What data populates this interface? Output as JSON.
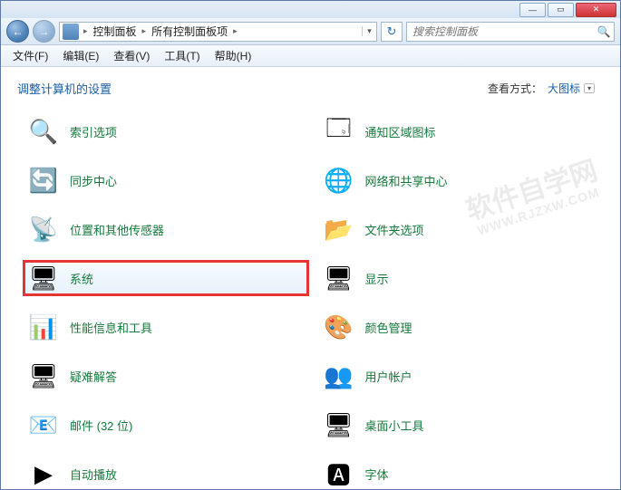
{
  "titlebar": {
    "min": "—",
    "max": "▭",
    "close": "✕"
  },
  "nav": {
    "back": "←",
    "fwd": "→",
    "crumbs": [
      "控制面板",
      "所有控制面板项"
    ],
    "sep": "▸",
    "dropdown": "▾",
    "refresh": "↻"
  },
  "search": {
    "placeholder": "搜索控制面板",
    "icon": "🔍"
  },
  "menus": [
    {
      "k": "file",
      "t": "文件(F)"
    },
    {
      "k": "edit",
      "t": "编辑(E)"
    },
    {
      "k": "view",
      "t": "查看(V)"
    },
    {
      "k": "tools",
      "t": "工具(T)"
    },
    {
      "k": "help",
      "t": "帮助(H)"
    }
  ],
  "page": {
    "title": "调整计算机的设置",
    "view_label": "查看方式：",
    "view_value": "大图标",
    "view_dd": "▾"
  },
  "items_left": [
    {
      "k": "indexing",
      "t": "索引选项",
      "ico": "🔍"
    },
    {
      "k": "sync",
      "t": "同步中心",
      "ico": "🔄"
    },
    {
      "k": "sensors",
      "t": "位置和其他传感器",
      "ico": "📡"
    },
    {
      "k": "system",
      "t": "系统",
      "ico": "🖥",
      "hl": true
    },
    {
      "k": "perf",
      "t": "性能信息和工具",
      "ico": "📊"
    },
    {
      "k": "trouble",
      "t": "疑难解答",
      "ico": "🖥"
    },
    {
      "k": "mail",
      "t": "邮件 (32 位)",
      "ico": "📧"
    },
    {
      "k": "autoplay",
      "t": "自动播放",
      "ico": "▶"
    }
  ],
  "items_right": [
    {
      "k": "tray",
      "t": "通知区域图标",
      "ico": "🗔"
    },
    {
      "k": "network",
      "t": "网络和共享中心",
      "ico": "🌐"
    },
    {
      "k": "folder",
      "t": "文件夹选项",
      "ico": "📂"
    },
    {
      "k": "display",
      "t": "显示",
      "ico": "🖥"
    },
    {
      "k": "color",
      "t": "颜色管理",
      "ico": "🎨"
    },
    {
      "k": "users",
      "t": "用户帐户",
      "ico": "👥"
    },
    {
      "k": "gadgets",
      "t": "桌面小工具",
      "ico": "🖥"
    },
    {
      "k": "fonts",
      "t": "字体",
      "ico": "🅰"
    }
  ],
  "watermark": {
    "line1": "软件自学网",
    "line2": "WWW.RJZXW.COM"
  }
}
